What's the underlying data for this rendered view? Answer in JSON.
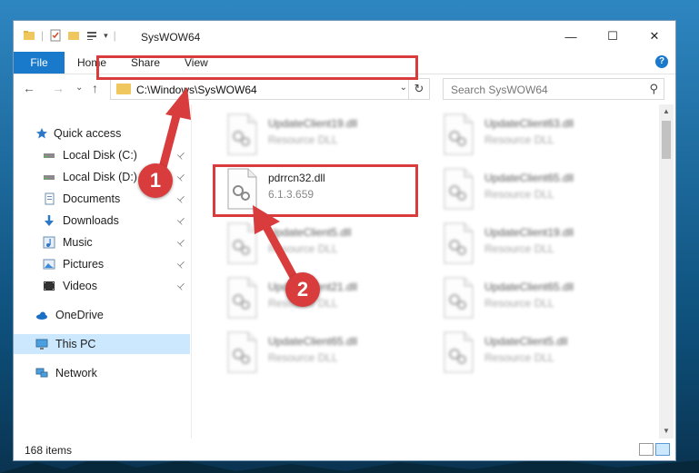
{
  "window": {
    "title": "SysWOW64",
    "minimize_glyph": "—",
    "maximize_glyph": "☐",
    "close_glyph": "✕"
  },
  "ribbon": {
    "file": "File",
    "tabs": [
      "Home",
      "Share",
      "View"
    ],
    "help": "?"
  },
  "nav": {
    "back": "←",
    "forward": "→",
    "recent": "⌄",
    "up": "↑"
  },
  "address": {
    "path": "C:\\Windows\\SysWOW64",
    "dropdown": "⌄",
    "refresh": "↻"
  },
  "search": {
    "placeholder": "Search SysWOW64",
    "icon": "search-icon"
  },
  "sidebar": {
    "items": [
      {
        "label": "Quick access",
        "icon": "star-icon",
        "pinned": false
      },
      {
        "label": "Local Disk (C:)",
        "icon": "drive-icon",
        "pinned": true
      },
      {
        "label": "Local Disk (D:)",
        "icon": "drive-icon",
        "pinned": true
      },
      {
        "label": "Documents",
        "icon": "documents-icon",
        "pinned": true
      },
      {
        "label": "Downloads",
        "icon": "download-icon",
        "pinned": true
      },
      {
        "label": "Music",
        "icon": "music-icon",
        "pinned": true
      },
      {
        "label": "Pictures",
        "icon": "pictures-icon",
        "pinned": true
      },
      {
        "label": "Videos",
        "icon": "videos-icon",
        "pinned": true
      },
      {
        "label": "OneDrive",
        "icon": "cloud-icon",
        "pinned": false
      },
      {
        "label": "This PC",
        "icon": "computer-icon",
        "pinned": false,
        "selected": true
      },
      {
        "label": "Network",
        "icon": "network-icon",
        "pinned": false
      }
    ],
    "pin_glyph": "📌"
  },
  "files": {
    "left": [
      {
        "name": "UpdateClient19.dll",
        "desc": "Resource DLL"
      },
      {
        "name": "pdrrcn32.dll",
        "desc": "6.1.3.659",
        "highlighted": true
      },
      {
        "name": "UpdateClient5.dll",
        "desc": "Resource DLL"
      },
      {
        "name": "UpdateClient21.dll",
        "desc": "Resource DLL"
      },
      {
        "name": "UpdateClient65.dll",
        "desc": "Resource DLL"
      }
    ],
    "right": [
      {
        "name": "UpdateClient63.dll",
        "desc": "Resource DLL"
      },
      {
        "name": "UpdateClient65.dll",
        "desc": "Resource DLL"
      },
      {
        "name": "UpdateClient19.dll",
        "desc": "Resource DLL"
      },
      {
        "name": "UpdateClient65.dll",
        "desc": "Resource DLL"
      },
      {
        "name": "UpdateClient5.dll",
        "desc": "Resource DLL"
      }
    ]
  },
  "status": {
    "count": "168 items"
  },
  "scroll": {
    "up": "▲",
    "down": "▼"
  },
  "annotations": {
    "step1": "1",
    "step2": "2",
    "color": "#d93c3c"
  },
  "colors": {
    "accent": "#1979ca",
    "selection": "#cce8ff"
  }
}
